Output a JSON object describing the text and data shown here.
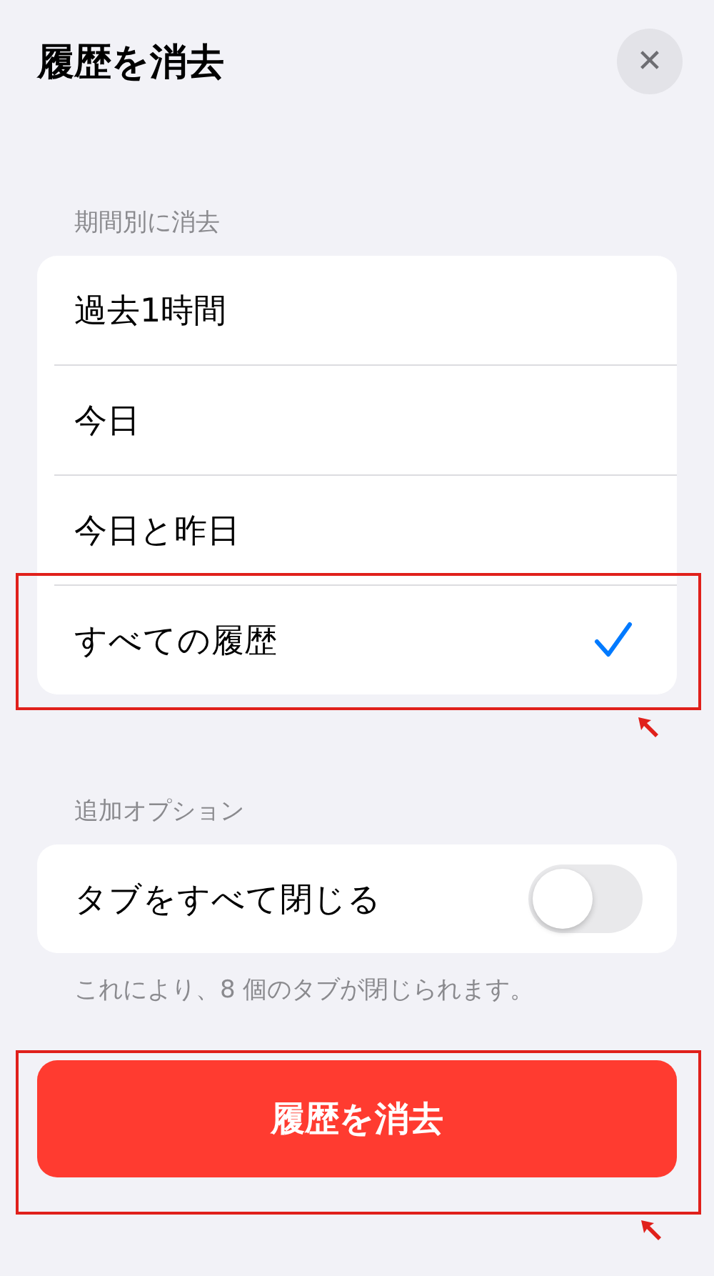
{
  "title": "履歴を消去",
  "close_button": {
    "label": "✕"
  },
  "period_section": {
    "header": "期間別に消去",
    "options": [
      {
        "label": "過去1時間",
        "selected": false
      },
      {
        "label": "今日",
        "selected": false
      },
      {
        "label": "今日と昨日",
        "selected": false
      },
      {
        "label": "すべての履歴",
        "selected": true
      }
    ]
  },
  "options_section": {
    "header": "追加オプション",
    "toggle": {
      "label": "タブをすべて閉じる",
      "on": false
    },
    "footer": "これにより、8 個のタブが閉じられます。"
  },
  "clear_button": {
    "label": "履歴を消去"
  }
}
